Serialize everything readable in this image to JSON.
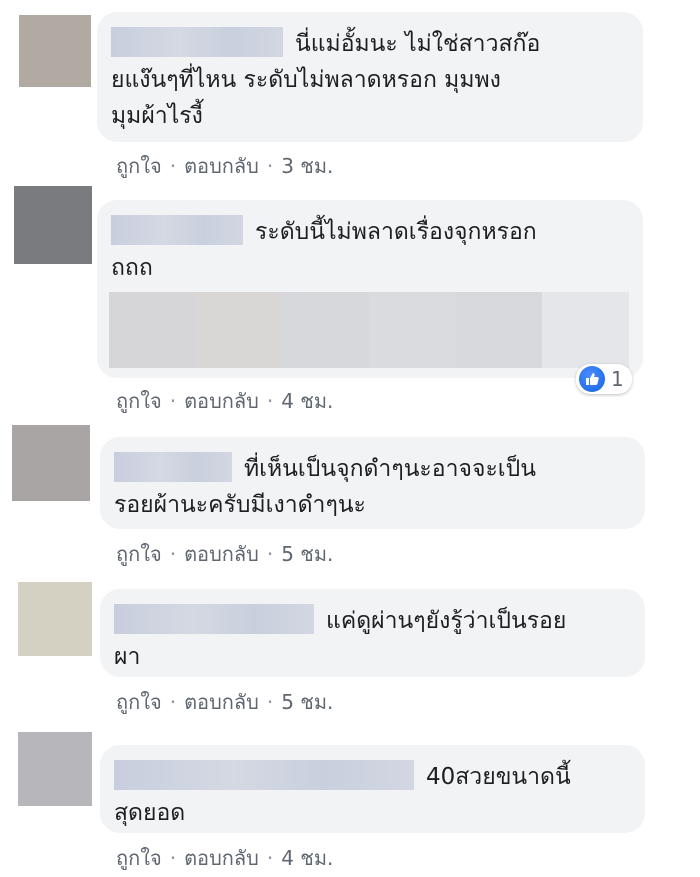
{
  "actions": {
    "like": "ถูกใจ",
    "reply": "ตอบกลับ",
    "dot": "·"
  },
  "comments": [
    {
      "text": "นี่แม่อั้มนะ ไม่ใช่สาวสก๊อ\nยแง๊นๆที่ไหน ระดับไม่พลาดหรอก มุมพง\nมุมผ้าไรงี้",
      "time": "3 ชม.",
      "avatar_color": "#b0aaa3"
    },
    {
      "text": "ระดับนี้ไม่พลาดเรื่องจุกหรอก\nถถถ",
      "time": "4 ชม.",
      "avatar_color": "#7a7b7e",
      "reaction_count": "1"
    },
    {
      "text": "ที่เห็นเป็นจุกดำๆนะอาจจะเป็น\nรอยผ้านะครับมีเงาดำๆนะ",
      "time": "5 ชม.",
      "avatar_color": "#a9a5a5"
    },
    {
      "text": "แค่ดูผ่านๆยังรู้ว่าเป็นรอย\nผา",
      "time": "5 ชม.",
      "avatar_color": "#d4d0c2"
    },
    {
      "text": "40สวยขนาดนี้\nสุดยอด",
      "time": "4 ชม.",
      "avatar_color": "#b7b6bb"
    }
  ]
}
